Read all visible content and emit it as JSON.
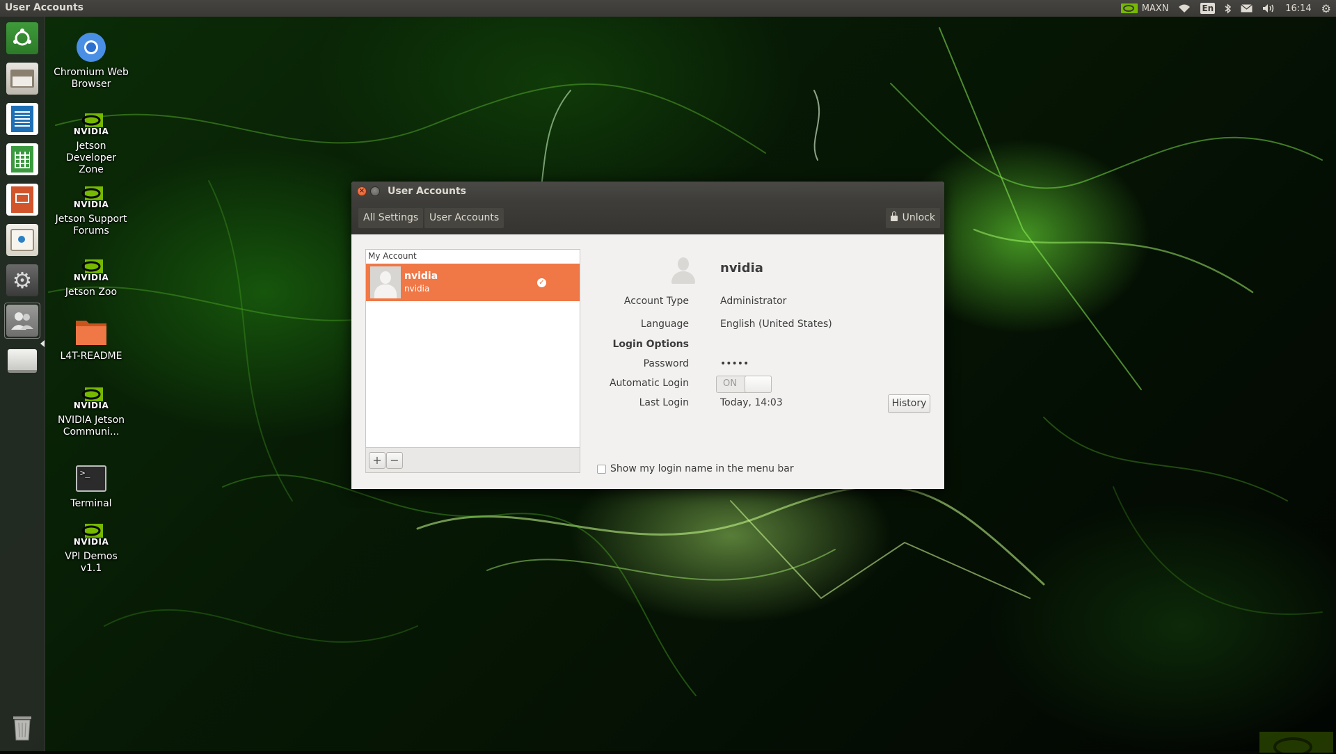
{
  "top_panel": {
    "title": "User Accounts",
    "power_mode": "MAXN",
    "keyboard_layout": "En",
    "clock": "16:14",
    "icons": [
      "nvidia-icon",
      "wifi-icon",
      "keyboard-icon",
      "bluetooth-icon",
      "mail-icon",
      "volume-icon",
      "gear-icon"
    ]
  },
  "launcher": {
    "items": [
      "ubuntu-dash",
      "files",
      "writer",
      "calc",
      "impress",
      "software-center",
      "system-settings",
      "user-accounts",
      "disk",
      "trash"
    ]
  },
  "desktop": {
    "icons": [
      {
        "name": "chromium",
        "label": "Chromium Web Browser"
      },
      {
        "name": "jetson-dev-zone",
        "logo": "NVIDIA",
        "label": "Jetson Developer Zone"
      },
      {
        "name": "jetson-forums",
        "logo": "NVIDIA",
        "label": "Jetson Support Forums"
      },
      {
        "name": "jetson-zoo",
        "logo": "NVIDIA",
        "label": "Jetson Zoo"
      },
      {
        "name": "l4t-readme",
        "label": "L4T-README"
      },
      {
        "name": "jetson-community",
        "logo": "NVIDIA",
        "label": "NVIDIA Jetson Communi..."
      },
      {
        "name": "terminal",
        "label": "Terminal"
      },
      {
        "name": "vpi-demos",
        "logo": "NVIDIA",
        "label": "VPI Demos v1.1"
      }
    ]
  },
  "window": {
    "title": "User Accounts",
    "toolbar": {
      "all_settings": "All Settings",
      "user_accounts": "User Accounts",
      "unlock": "Unlock"
    },
    "list": {
      "header": "My Account",
      "users": [
        {
          "name": "nvidia",
          "login": "nvidia"
        }
      ],
      "add": "+",
      "remove": "−"
    },
    "details": {
      "name": "nvidia",
      "account_type_label": "Account Type",
      "account_type": "Administrator",
      "language_label": "Language",
      "language": "English (United States)",
      "login_options_label": "Login Options",
      "password_label": "Password",
      "password": "•••••",
      "auto_login_label": "Automatic Login",
      "auto_login_state": "ON",
      "last_login_label": "Last Login",
      "last_login": "Today, 14:03",
      "history_button": "History",
      "show_login_name": "Show my login name in the menu bar"
    }
  },
  "colors": {
    "accent": "#f07746",
    "panel": "#3c3b37",
    "nvidia_green": "#76b900"
  }
}
